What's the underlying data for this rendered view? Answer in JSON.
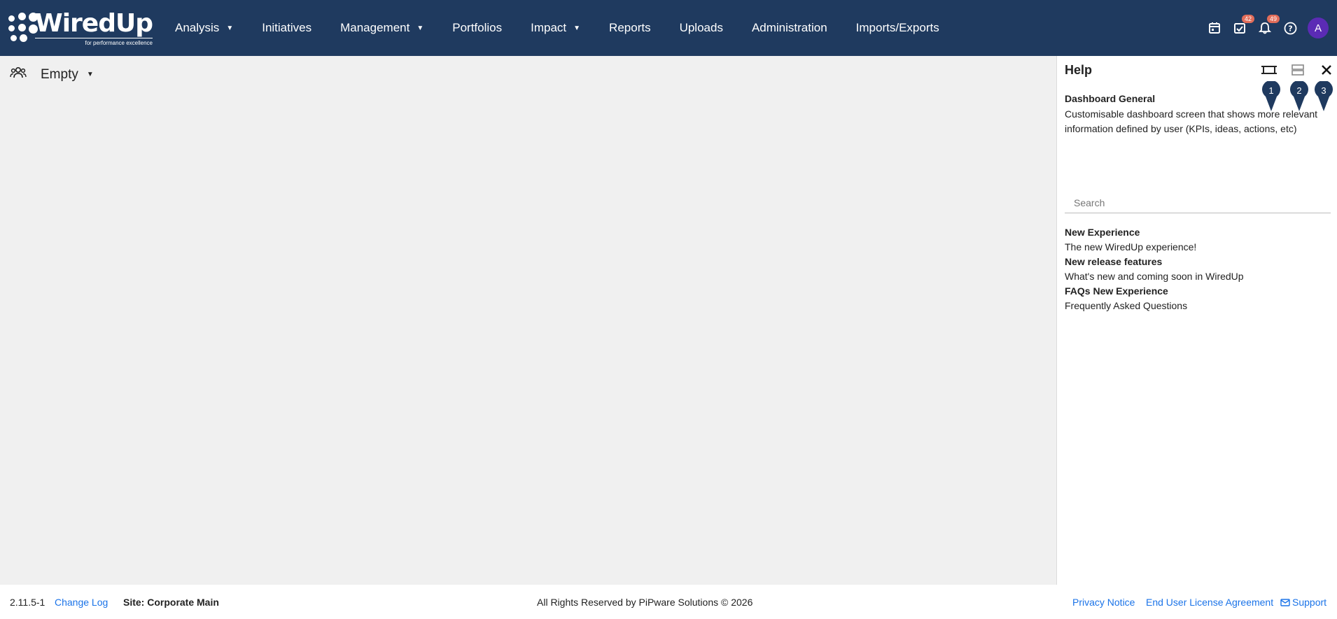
{
  "brand": {
    "name": "WiredUp",
    "tagline": "for performance excellence"
  },
  "nav": [
    {
      "label": "Analysis",
      "has_dropdown": true
    },
    {
      "label": "Initiatives",
      "has_dropdown": false
    },
    {
      "label": "Management",
      "has_dropdown": true
    },
    {
      "label": "Portfolios",
      "has_dropdown": false
    },
    {
      "label": "Impact",
      "has_dropdown": true
    },
    {
      "label": "Reports",
      "has_dropdown": false
    },
    {
      "label": "Uploads",
      "has_dropdown": false
    },
    {
      "label": "Administration",
      "has_dropdown": false
    },
    {
      "label": "Imports/Exports",
      "has_dropdown": false
    }
  ],
  "top_icons": {
    "calendar_icon": "calendar-icon",
    "tasks_icon": "tasks-check-icon",
    "tasks_badge": "42",
    "bell_icon": "bell-icon",
    "notifications_badge": "49",
    "help_icon": "help-circle-icon",
    "avatar_letter": "A"
  },
  "dashboard": {
    "selector_icon": "users-group-icon",
    "selected": "Empty"
  },
  "help_panel": {
    "title": "Help",
    "pins": [
      "1",
      "2",
      "3"
    ],
    "section_title": "Dashboard General",
    "section_desc": "Customisable dashboard screen that shows more relevant information defined by user (KPIs, ideas, actions, etc)",
    "search_placeholder": "Search",
    "links": [
      {
        "title": "New Experience",
        "desc": "The new WiredUp experience!"
      },
      {
        "title": "New release features",
        "desc": "What's new and coming soon in WiredUp"
      },
      {
        "title": "FAQs New Experience",
        "desc": "Frequently Asked Questions"
      }
    ]
  },
  "footer": {
    "version": "2.11.5-1",
    "change_log": "Change Log",
    "site": "Site: Corporate Main",
    "rights": "All Rights Reserved by PiPware Solutions © 2026",
    "privacy": "Privacy Notice",
    "eula": "End User License Agreement",
    "support": "Support"
  },
  "colors": {
    "topbar": "#1f3a5f",
    "link": "#1a73e8",
    "badge": "#e26d5a",
    "avatar": "#5b2bb5",
    "pin": "#1f3a5f"
  }
}
